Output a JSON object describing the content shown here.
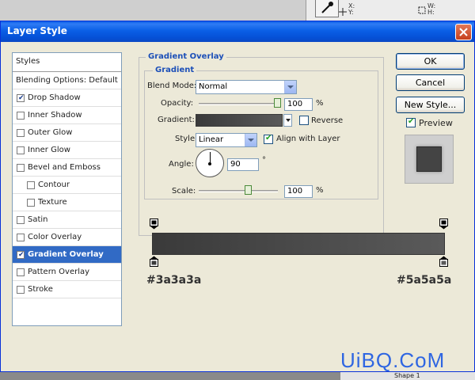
{
  "app": {
    "toolbar_xy": "X:\nY:",
    "toolbar_wh": "W:\nH:",
    "layers_hint": "Shape 1"
  },
  "dialog": {
    "title": "Layer Style"
  },
  "styles": {
    "header": "Styles",
    "items": [
      {
        "label": "Blending Options: Default",
        "checkbox": false,
        "checked": false,
        "indent": false,
        "selected": false
      },
      {
        "label": "Drop Shadow",
        "checkbox": true,
        "checked": true,
        "indent": false,
        "selected": false
      },
      {
        "label": "Inner Shadow",
        "checkbox": true,
        "checked": false,
        "indent": false,
        "selected": false
      },
      {
        "label": "Outer Glow",
        "checkbox": true,
        "checked": false,
        "indent": false,
        "selected": false
      },
      {
        "label": "Inner Glow",
        "checkbox": true,
        "checked": false,
        "indent": false,
        "selected": false
      },
      {
        "label": "Bevel and Emboss",
        "checkbox": true,
        "checked": false,
        "indent": false,
        "selected": false
      },
      {
        "label": "Contour",
        "checkbox": true,
        "checked": false,
        "indent": true,
        "selected": false
      },
      {
        "label": "Texture",
        "checkbox": true,
        "checked": false,
        "indent": true,
        "selected": false
      },
      {
        "label": "Satin",
        "checkbox": true,
        "checked": false,
        "indent": false,
        "selected": false
      },
      {
        "label": "Color Overlay",
        "checkbox": true,
        "checked": false,
        "indent": false,
        "selected": false
      },
      {
        "label": "Gradient Overlay",
        "checkbox": true,
        "checked": true,
        "indent": false,
        "selected": true
      },
      {
        "label": "Pattern Overlay",
        "checkbox": true,
        "checked": false,
        "indent": false,
        "selected": false
      },
      {
        "label": "Stroke",
        "checkbox": true,
        "checked": false,
        "indent": false,
        "selected": false
      }
    ]
  },
  "gradient_overlay": {
    "legend": "Gradient Overlay",
    "sub_legend": "Gradient",
    "blend_mode_label": "Blend Mode:",
    "blend_mode_value": "Normal",
    "opacity_label": "Opacity:",
    "opacity_value": "100",
    "opacity_level": 1.0,
    "percent": "%",
    "gradient_label": "Gradient:",
    "reverse_label": "Reverse",
    "reverse_checked": false,
    "style_label": "Style:",
    "style_value": "Linear",
    "align_label": "Align with Layer",
    "align_checked": true,
    "angle_label": "Angle:",
    "angle_value": "90",
    "degree": "°",
    "scale_label": "Scale:",
    "scale_value": "100",
    "scale_level": 0.6
  },
  "buttons": {
    "ok": "OK",
    "cancel": "Cancel",
    "new_style": "New Style...",
    "preview": "Preview",
    "preview_checked": true
  },
  "gradient_editor": {
    "start_color": "#3a3a3a",
    "end_color": "#5a5a5a",
    "start_label": "#3a3a3a",
    "end_label": "#5a5a5a"
  },
  "watermark": "UiBQ.CoM"
}
